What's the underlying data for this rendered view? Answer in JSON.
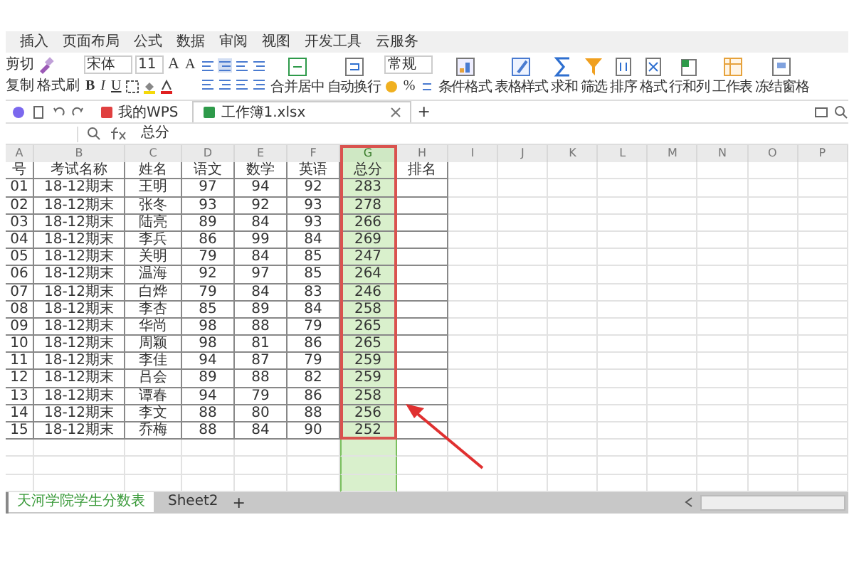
{
  "ribbon_tabs": [
    "插入",
    "页面布局",
    "公式",
    "数据",
    "审阅",
    "视图",
    "开发工具",
    "云服务"
  ],
  "clipboard": {
    "cut": "剪切",
    "copy": "复制",
    "format_painter": "格式刷"
  },
  "font": {
    "name": "宋体",
    "size": "11",
    "size_buttons": [
      "A",
      "A"
    ],
    "styles": [
      "B",
      "I",
      "U"
    ]
  },
  "merge_buttons": [
    {
      "label": "合并居中"
    },
    {
      "label": "自动换行"
    }
  ],
  "number": {
    "format": "常规",
    "percent": "%"
  },
  "tool_buttons": [
    {
      "label": "条件格式"
    },
    {
      "label": "表格样式"
    },
    {
      "label": "求和"
    },
    {
      "label": "筛选"
    },
    {
      "label": "排序"
    },
    {
      "label": "格式"
    },
    {
      "label": "行和列"
    },
    {
      "label": "工作表"
    },
    {
      "label": "冻结窗格"
    }
  ],
  "document_tabs": [
    {
      "label": "我的WPS",
      "selected": false,
      "closable": false
    },
    {
      "label": "工作簿1.xlsx",
      "selected": true,
      "closable": true
    }
  ],
  "new_tab": "+",
  "formula_bar": {
    "content": "总分"
  },
  "columns": [
    {
      "letter": "A",
      "selected": false,
      "highlighted": false
    },
    {
      "letter": "B",
      "selected": false,
      "highlighted": false
    },
    {
      "letter": "C",
      "selected": false,
      "highlighted": false
    },
    {
      "letter": "D",
      "selected": false,
      "highlighted": false
    },
    {
      "letter": "E",
      "selected": false,
      "highlighted": false
    },
    {
      "letter": "F",
      "selected": false,
      "highlighted": false
    },
    {
      "letter": "G",
      "selected": true,
      "highlighted": true
    },
    {
      "letter": "H",
      "selected": false,
      "highlighted": false
    },
    {
      "letter": "I",
      "selected": false,
      "highlighted": false
    },
    {
      "letter": "J",
      "selected": false,
      "highlighted": false
    },
    {
      "letter": "K",
      "selected": false,
      "highlighted": false
    },
    {
      "letter": "L",
      "selected": false,
      "highlighted": false
    },
    {
      "letter": "M",
      "selected": false,
      "highlighted": false
    },
    {
      "letter": "N",
      "selected": false,
      "highlighted": false
    },
    {
      "letter": "O",
      "selected": false,
      "highlighted": false
    },
    {
      "letter": "P",
      "selected": false,
      "highlighted": false
    }
  ],
  "header_row": [
    "号",
    "考试名称",
    "姓名",
    "语文",
    "数学",
    "英语",
    "总分",
    "排名"
  ],
  "rows": [
    [
      "01",
      "18-12期末",
      "王明",
      "97",
      "94",
      "92",
      "283"
    ],
    [
      "02",
      "18-12期末",
      "张冬",
      "93",
      "92",
      "93",
      "278"
    ],
    [
      "03",
      "18-12期末",
      "陆亮",
      "89",
      "84",
      "93",
      "266"
    ],
    [
      "04",
      "18-12期末",
      "李兵",
      "86",
      "99",
      "84",
      "269"
    ],
    [
      "05",
      "18-12期末",
      "关明",
      "79",
      "84",
      "85",
      "247"
    ],
    [
      "06",
      "18-12期末",
      "温海",
      "92",
      "97",
      "85",
      "264"
    ],
    [
      "07",
      "18-12期末",
      "白烨",
      "79",
      "84",
      "83",
      "246"
    ],
    [
      "08",
      "18-12期末",
      "李杏",
      "85",
      "89",
      "84",
      "258"
    ],
    [
      "09",
      "18-12期末",
      "华尚",
      "98",
      "88",
      "79",
      "265"
    ],
    [
      "10",
      "18-12期末",
      "周颖",
      "98",
      "81",
      "86",
      "265"
    ],
    [
      "11",
      "18-12期末",
      "李佳",
      "94",
      "87",
      "79",
      "259"
    ],
    [
      "12",
      "18-12期末",
      "吕会",
      "89",
      "88",
      "82",
      "259"
    ],
    [
      "13",
      "18-12期末",
      "谭春",
      "94",
      "79",
      "86",
      "258"
    ],
    [
      "14",
      "18-12期末",
      "李文",
      "88",
      "80",
      "88",
      "256"
    ],
    [
      "15",
      "18-12期末",
      "乔梅",
      "88",
      "84",
      "90",
      "252"
    ]
  ],
  "sheet_tabs": [
    {
      "label": "天河学院学生分数表",
      "selected": true
    },
    {
      "label": "Sheet2",
      "selected": false
    }
  ],
  "add_sheet": "+"
}
